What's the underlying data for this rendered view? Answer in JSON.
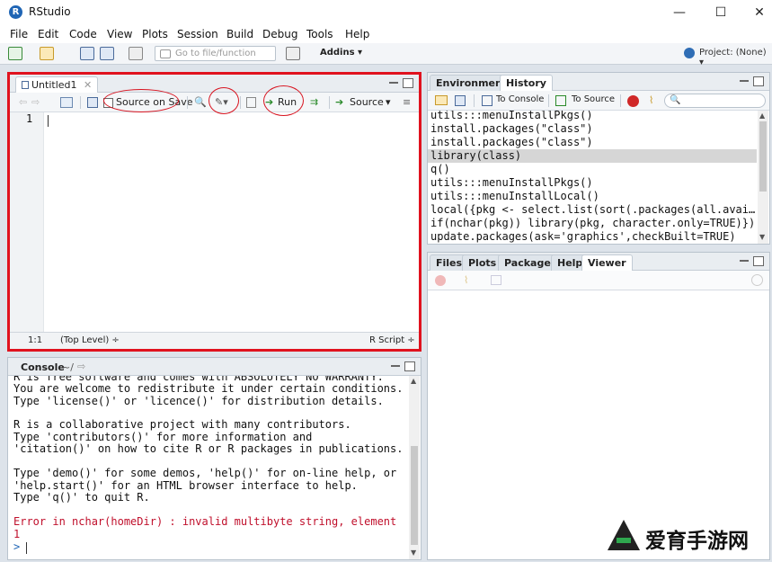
{
  "window": {
    "title": "RStudio",
    "logo_letter": "R",
    "minimize": "—",
    "maximize": "☐",
    "close": "✕"
  },
  "menu": [
    "File",
    "Edit",
    "Code",
    "View",
    "Plots",
    "Session",
    "Build",
    "Debug",
    "Tools",
    "Help"
  ],
  "toolbar": {
    "goto_placeholder": "Go to file/function",
    "addins": "Addins ▾",
    "project": "Project: (None) ▾"
  },
  "editor": {
    "tab_label": "Untitled1",
    "source_on_save": "Source on Save",
    "run": "Run",
    "source": "Source",
    "line_number": "1",
    "status_pos": "1:1",
    "status_level": "(Top Level) ÷",
    "status_lang": "R Script ÷"
  },
  "env_pane": {
    "tabs": [
      "Environment",
      "History"
    ],
    "to_console": "To Console",
    "to_source": "To Source",
    "history": [
      "utils:::menuInstallPkgs()",
      "install.packages(\"class\")",
      "install.packages(\"class\")",
      "library(class)",
      "q()",
      "utils:::menuInstallPkgs()",
      "utils:::menuInstallLocal()",
      "local({pkg <- select.list(sort(.packages(all.avai…",
      "if(nchar(pkg)) library(pkg, character.only=TRUE)})",
      "update.packages(ask='graphics',checkBuilt=TRUE)"
    ]
  },
  "files_pane": {
    "tabs": [
      "Files",
      "Plots",
      "Packages",
      "Help",
      "Viewer"
    ]
  },
  "console": {
    "title": "Console",
    "path": "~/",
    "lines": [
      {
        "text": "R is free software and comes with ABSOLUTELY NO WARRANTY.",
        "kind": "normal"
      },
      {
        "text": "You are welcome to redistribute it under certain conditions.",
        "kind": "normal"
      },
      {
        "text": "Type 'license()' or 'licence()' for distribution details.",
        "kind": "normal"
      },
      {
        "text": "",
        "kind": "normal"
      },
      {
        "text": "R is a collaborative project with many contributors.",
        "kind": "normal"
      },
      {
        "text": "Type 'contributors()' for more information and",
        "kind": "normal"
      },
      {
        "text": "'citation()' on how to cite R or R packages in publications.",
        "kind": "normal"
      },
      {
        "text": "",
        "kind": "normal"
      },
      {
        "text": "Type 'demo()' for some demos, 'help()' for on-line help, or",
        "kind": "normal"
      },
      {
        "text": "'help.start()' for an HTML browser interface to help.",
        "kind": "normal"
      },
      {
        "text": "Type 'q()' to quit R.",
        "kind": "normal"
      },
      {
        "text": "",
        "kind": "normal"
      },
      {
        "text": "Error in nchar(homeDir) : invalid multibyte string, element",
        "kind": "error"
      },
      {
        "text": "1",
        "kind": "error"
      }
    ],
    "prompt": ">"
  },
  "watermark": {
    "text": "爱育手游网"
  },
  "colors": {
    "highlight_border": "#e0121e",
    "error_text": "#c0102c",
    "prompt": "#1f65b5"
  }
}
